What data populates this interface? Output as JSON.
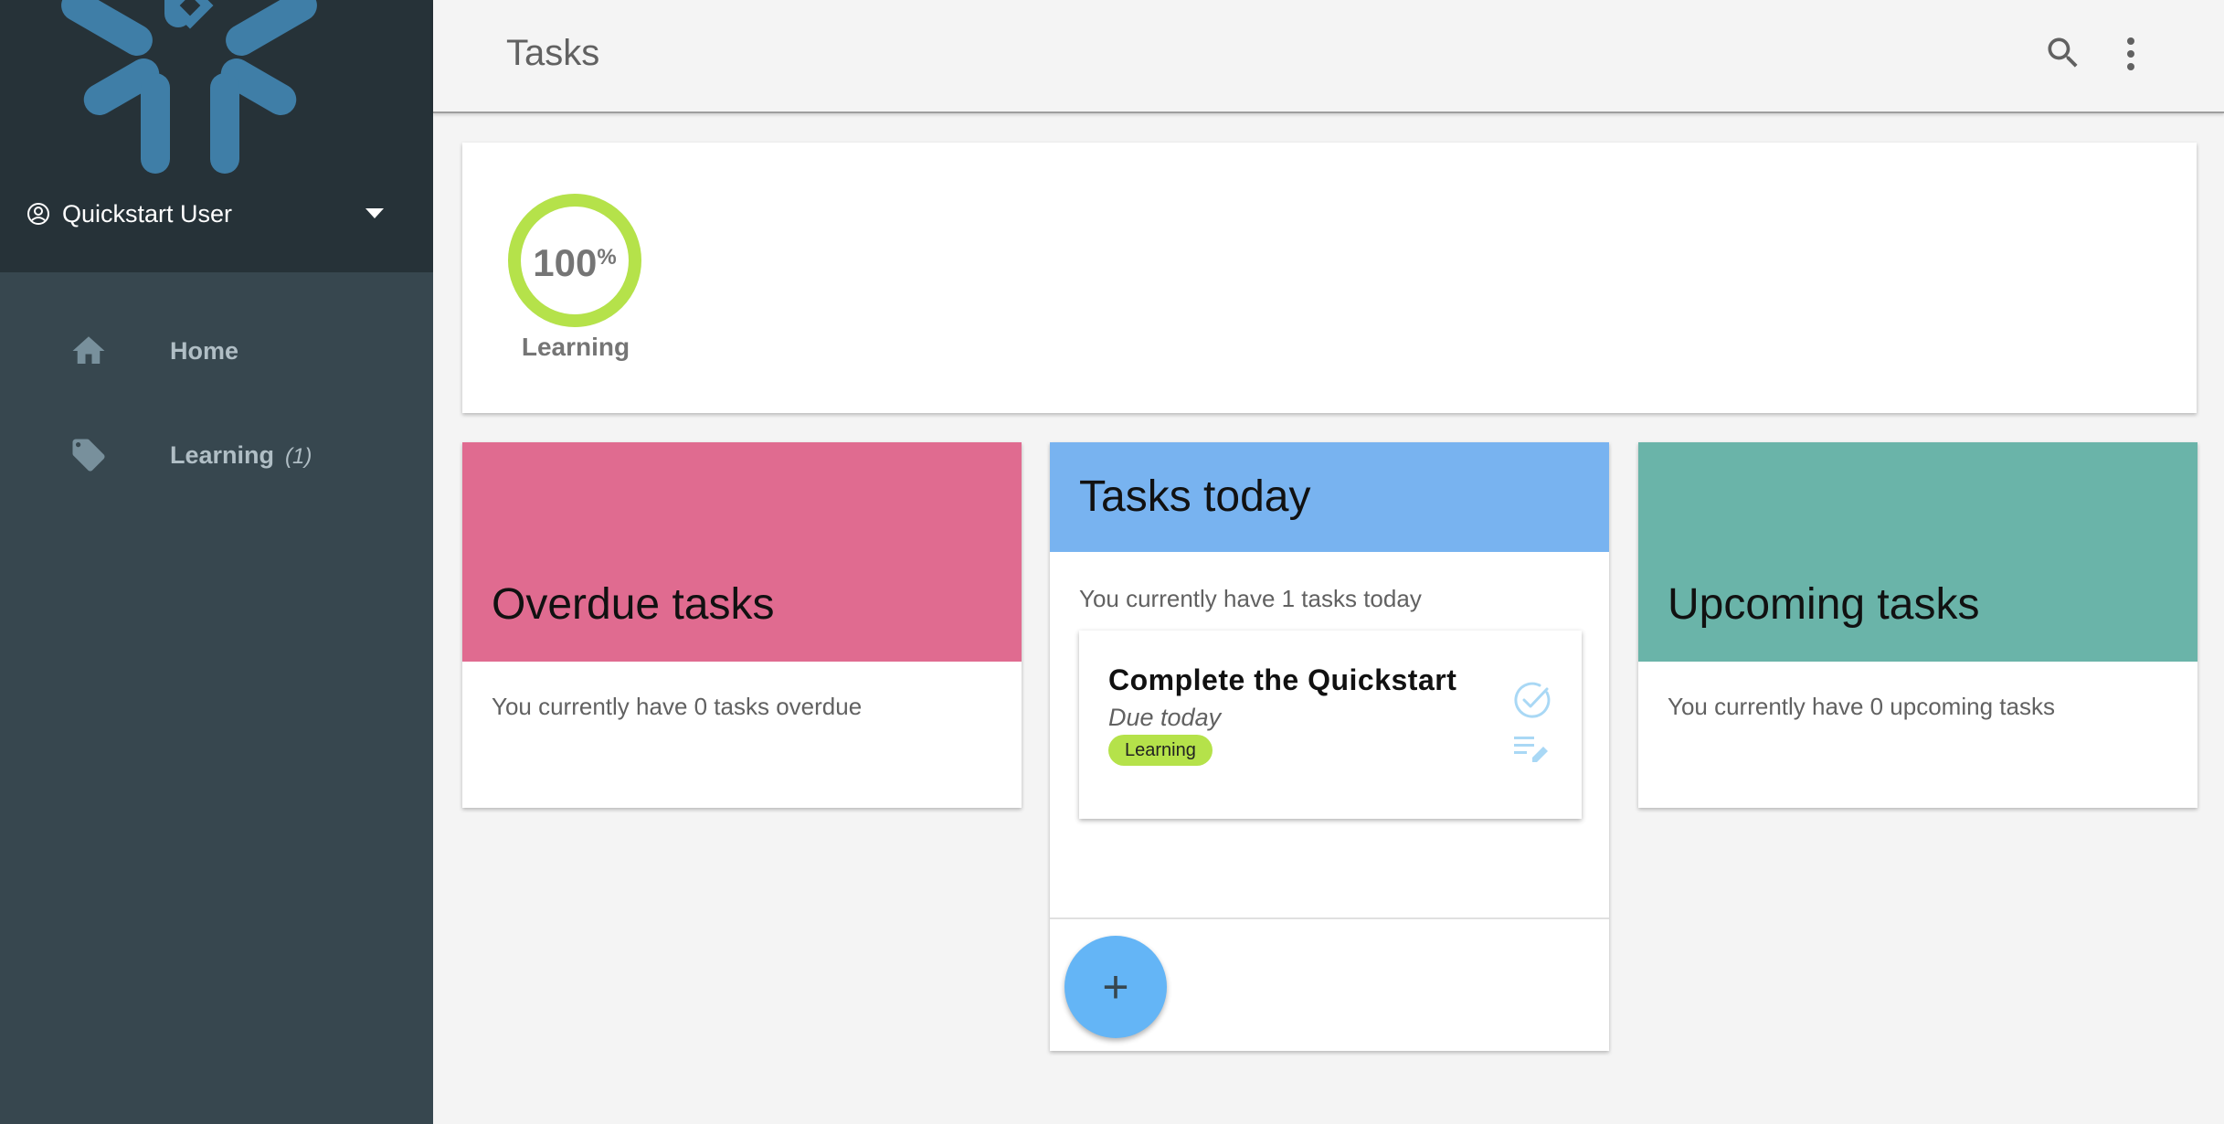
{
  "sidebar": {
    "user": {
      "name": "Quickstart User"
    },
    "nav": [
      {
        "label": "Home",
        "icon": "home-icon"
      },
      {
        "label": "Learning",
        "icon": "tag-icon",
        "count": "(1)"
      }
    ]
  },
  "header": {
    "title": "Tasks"
  },
  "progress": {
    "value": "100",
    "unit": "%",
    "fraction": 1.0,
    "label": "Learning",
    "color": "#b5e24a"
  },
  "columns": {
    "overdue": {
      "title": "Overdue tasks",
      "text": "You currently have 0 tasks overdue",
      "color": "#e06b90"
    },
    "today": {
      "title": "Tasks today",
      "text": "You currently have 1 tasks today",
      "color": "#78b3f0",
      "tasks": [
        {
          "title": "Complete the Quickstart",
          "due": "Due today",
          "tag": "Learning"
        }
      ],
      "add_label": "+"
    },
    "upcoming": {
      "title": "Upcoming tasks",
      "text": "You currently have 0 upcoming tasks",
      "color": "#6ab4a9"
    }
  }
}
